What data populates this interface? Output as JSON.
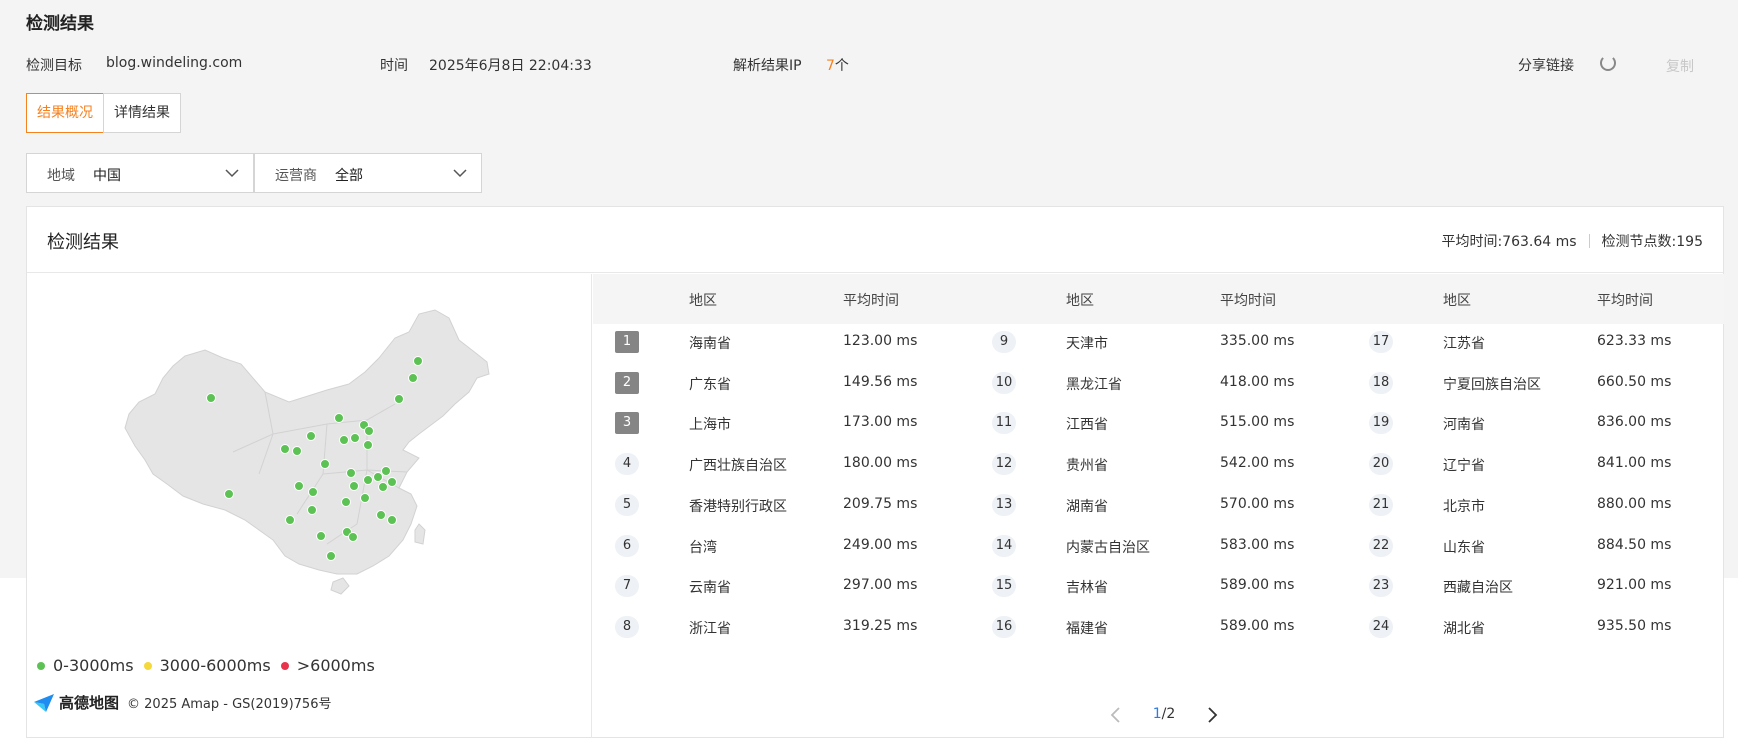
{
  "page": {
    "title": "检测结果"
  },
  "info": {
    "target_label": "检测目标",
    "target_value": "blog.windeling.com",
    "time_label": "时间",
    "time_value": "2025年6月8日 22:04:33",
    "ip_label": "解析结果IP",
    "ip_count": "7",
    "ip_unit": "个",
    "share_label": "分享链接",
    "copy_label": "复制"
  },
  "tabs": [
    {
      "label": "结果概况",
      "active": true
    },
    {
      "label": "详情结果",
      "active": false
    }
  ],
  "filters": {
    "region": {
      "label": "地域",
      "value": "中国"
    },
    "isp": {
      "label": "运营商",
      "value": "全部"
    }
  },
  "card": {
    "title": "检测结果",
    "avg_time": "平均时间:763.64 ms",
    "node_count": "检测节点数:195"
  },
  "legend": [
    {
      "label": "0-3000ms",
      "color": "#5cc254"
    },
    {
      "label": "3000-6000ms",
      "color": "#f5d83a"
    },
    {
      "label": ">6000ms",
      "color": "#e8334d"
    }
  ],
  "map_credit": {
    "brand": "高德地图",
    "text": "© 2025 Amap - GS(2019)756号"
  },
  "table": {
    "head_region": "地区",
    "head_time": "平均时间",
    "columns": [
      [
        {
          "rank": "1",
          "region": "海南省",
          "time": "123.00 ms"
        },
        {
          "rank": "2",
          "region": "广东省",
          "time": "149.56 ms"
        },
        {
          "rank": "3",
          "region": "上海市",
          "time": "173.00 ms"
        },
        {
          "rank": "4",
          "region": "广西壮族自治区",
          "time": "180.00 ms"
        },
        {
          "rank": "5",
          "region": "香港特别行政区",
          "time": "209.75 ms"
        },
        {
          "rank": "6",
          "region": "台湾",
          "time": "249.00 ms"
        },
        {
          "rank": "7",
          "region": "云南省",
          "time": "297.00 ms"
        },
        {
          "rank": "8",
          "region": "浙江省",
          "time": "319.25 ms"
        }
      ],
      [
        {
          "rank": "9",
          "region": "天津市",
          "time": "335.00 ms"
        },
        {
          "rank": "10",
          "region": "黑龙江省",
          "time": "418.00 ms"
        },
        {
          "rank": "11",
          "region": "江西省",
          "time": "515.00 ms"
        },
        {
          "rank": "12",
          "region": "贵州省",
          "time": "542.00 ms"
        },
        {
          "rank": "13",
          "region": "湖南省",
          "time": "570.00 ms"
        },
        {
          "rank": "14",
          "region": "内蒙古自治区",
          "time": "583.00 ms"
        },
        {
          "rank": "15",
          "region": "吉林省",
          "time": "589.00 ms"
        },
        {
          "rank": "16",
          "region": "福建省",
          "time": "589.00 ms"
        }
      ],
      [
        {
          "rank": "17",
          "region": "江苏省",
          "time": "623.33 ms"
        },
        {
          "rank": "18",
          "region": "宁夏回族自治区",
          "time": "660.50 ms"
        },
        {
          "rank": "19",
          "region": "河南省",
          "time": "836.00 ms"
        },
        {
          "rank": "20",
          "region": "辽宁省",
          "time": "841.00 ms"
        },
        {
          "rank": "21",
          "region": "北京市",
          "time": "880.00 ms"
        },
        {
          "rank": "22",
          "region": "山东省",
          "time": "884.50 ms"
        },
        {
          "rank": "23",
          "region": "西藏自治区",
          "time": "921.00 ms"
        },
        {
          "rank": "24",
          "region": "湖北省",
          "time": "935.50 ms"
        }
      ]
    ]
  },
  "pagination": {
    "current": "1",
    "total": "/2"
  },
  "icons": {
    "dropdown": "chevron-down-icon",
    "loading": "loading-spinner-icon",
    "prev": "chevron-left-icon",
    "next": "chevron-right-icon"
  }
}
